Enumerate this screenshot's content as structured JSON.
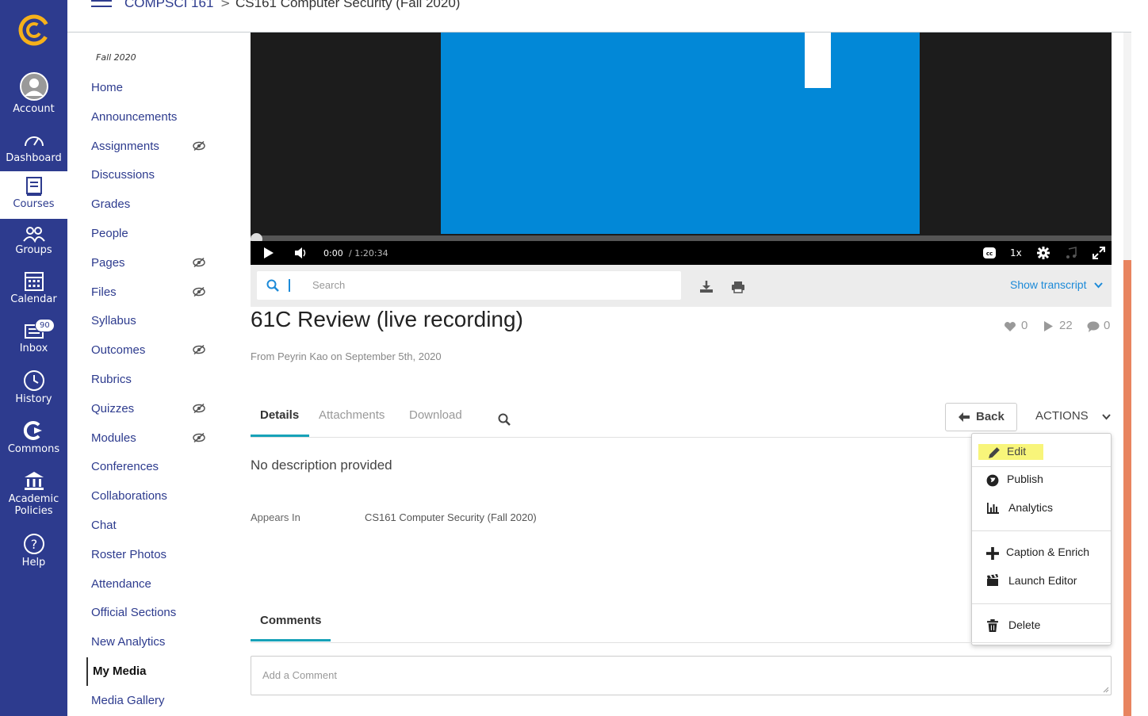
{
  "global_nav": {
    "items": [
      {
        "label": "Account",
        "icon": "account-icon"
      },
      {
        "label": "Dashboard",
        "icon": "dashboard-icon"
      },
      {
        "label": "Courses",
        "icon": "courses-icon"
      },
      {
        "label": "Groups",
        "icon": "groups-icon"
      },
      {
        "label": "Calendar",
        "icon": "calendar-icon"
      },
      {
        "label": "Inbox",
        "icon": "inbox-icon",
        "badge": "90"
      },
      {
        "label": "History",
        "icon": "history-icon"
      },
      {
        "label": "Commons",
        "icon": "commons-icon"
      },
      {
        "label": "Academic",
        "label2": "Policies",
        "icon": "academic-icon"
      },
      {
        "label": "Help",
        "icon": "help-icon"
      }
    ]
  },
  "breadcrumb": {
    "course": "COMPSCI 161",
    "separator": ">",
    "page": "CS161 Computer Security (Fall 2020)"
  },
  "course_nav": {
    "term": "Fall 2020",
    "items": [
      {
        "label": "Home"
      },
      {
        "label": "Announcements"
      },
      {
        "label": "Assignments",
        "hidden": true
      },
      {
        "label": "Discussions"
      },
      {
        "label": "Grades"
      },
      {
        "label": "People"
      },
      {
        "label": "Pages",
        "hidden": true
      },
      {
        "label": "Files",
        "hidden": true
      },
      {
        "label": "Syllabus"
      },
      {
        "label": "Outcomes",
        "hidden": true
      },
      {
        "label": "Rubrics"
      },
      {
        "label": "Quizzes",
        "hidden": true
      },
      {
        "label": "Modules",
        "hidden": true
      },
      {
        "label": "Conferences"
      },
      {
        "label": "Collaborations"
      },
      {
        "label": "Chat"
      },
      {
        "label": "Roster Photos"
      },
      {
        "label": "Attendance"
      },
      {
        "label": "Official Sections"
      },
      {
        "label": "New Analytics"
      },
      {
        "label": "My Media",
        "active": true
      },
      {
        "label": "Media Gallery"
      }
    ]
  },
  "player": {
    "current_time": "0:00",
    "duration": "/ 1:20:34",
    "speed": "1x",
    "progress": 0.0
  },
  "search": {
    "placeholder": "Search",
    "show_transcript": "Show transcript"
  },
  "media": {
    "title": "61C Review (live recording)",
    "likes": "0",
    "plays": "22",
    "comments": "0",
    "byline": "From Peyrin Kao on September 5th, 2020"
  },
  "tabs": [
    "Details",
    "Attachments",
    "Download"
  ],
  "back_label": "Back",
  "actions_label": "ACTIONS",
  "details": {
    "description": "No description provided",
    "appears_label": "Appears In",
    "appears_value": "CS161 Computer Security (Fall 2020)"
  },
  "dropdown": {
    "edit": "Edit",
    "publish": "Publish",
    "analytics": "Analytics",
    "caption": "Caption & Enrich",
    "launch_editor": "Launch Editor",
    "delete": "Delete"
  },
  "comments": {
    "tab_label": "Comments",
    "placeholder": "Add a Comment"
  },
  "colors": {
    "nav": "#2d3b8e",
    "link": "#2d3b8e",
    "accent": "#17a2b8",
    "slide": "#0288d7",
    "highlight": "#f8f57a",
    "scroll": "#e8845f"
  }
}
